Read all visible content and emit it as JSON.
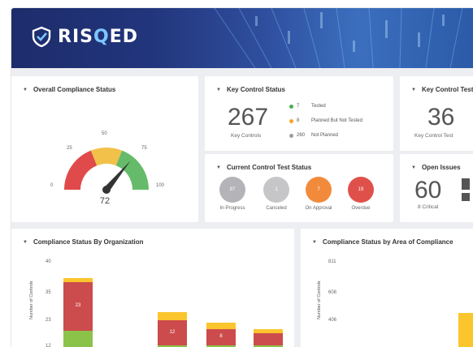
{
  "app": {
    "logo_prefix": "RIS",
    "logo_q": "Q",
    "logo_suffix": "ED"
  },
  "overall": {
    "title": "Overall Compliance Status",
    "value": "72",
    "ticks": {
      "t0": "0",
      "t25": "25",
      "t50": "50",
      "t75": "75",
      "t100": "100"
    },
    "gauge_value": 72,
    "gauge_max": 100
  },
  "key_control": {
    "title": "Key Control Status",
    "count": "267",
    "count_label": "Key Controls",
    "legend": [
      {
        "count": "7",
        "label": "Tested",
        "color": "#4caf50"
      },
      {
        "count": "8",
        "label": "Planned But Not Tested",
        "color": "#f5a623"
      },
      {
        "count": "260",
        "label": "Not Planned",
        "color": "#9e9e9e"
      }
    ]
  },
  "key_control_test": {
    "title": "Key Control Test",
    "count": "36",
    "count_label": "Key Control Test"
  },
  "current_test": {
    "title": "Current Control Test Status",
    "items": [
      {
        "value": "97",
        "label": "In-Progress",
        "color": "#b4b4b8"
      },
      {
        "value": "1",
        "label": "Canceled",
        "color": "#c6c6c9"
      },
      {
        "value": "7",
        "label": "On Approval",
        "color": "#f28a3c"
      },
      {
        "value": "19",
        "label": "Overdue",
        "color": "#e0504a"
      }
    ]
  },
  "open_issues": {
    "title": "Open Issues",
    "count": "60",
    "count_label": "8 Critical"
  },
  "by_org": {
    "title": "Compliance Status By Organization",
    "ylabel": "Number of Controls"
  },
  "by_area": {
    "title": "Compliance Status by Area of Compliance",
    "ylabel": "Number of Controls"
  },
  "chart_data": [
    {
      "type": "bar",
      "title": "Compliance Status By Organization",
      "ylabel": "Number of Controls",
      "yticks": [
        "40",
        "35",
        "23",
        "12"
      ],
      "ylim": [
        12,
        40
      ],
      "categories": [
        "",
        "",
        "",
        ""
      ],
      "series": [
        {
          "values": [
            13,
            6,
            6,
            6
          ],
          "color": "#8bc34a"
        },
        {
          "values": [
            23,
            12,
            8,
            6
          ],
          "color": "#cc4b4c",
          "labels": [
            "23",
            "12",
            "8",
            ""
          ]
        },
        {
          "values": [
            2,
            4,
            3,
            2
          ],
          "color": "#fbc52d"
        }
      ]
    },
    {
      "type": "bar",
      "title": "Compliance Status by Area of Compliance",
      "ylabel": "Number of Controls",
      "yticks": [
        "811",
        "608",
        "406"
      ],
      "ylim": [
        200,
        811
      ],
      "categories": [
        ""
      ],
      "series": [
        {
          "values": [
            400
          ],
          "color": "#fbc52d"
        }
      ]
    }
  ]
}
